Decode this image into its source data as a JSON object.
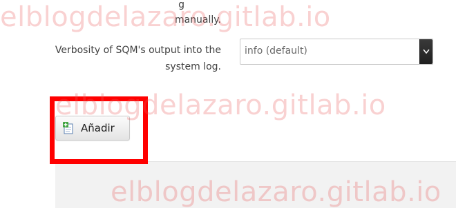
{
  "settings": {
    "cut_label": "g\nmanually.",
    "verbosity_label": "Verbosity of SQM's output into the system log.",
    "verbosity_value": "info (default)"
  },
  "actions": {
    "add_label": "Añadir"
  },
  "watermark": {
    "text": "elblogdelazaro.gitlab.io"
  },
  "colors": {
    "highlight": "#ff0000",
    "watermark": "#e95a5a"
  }
}
